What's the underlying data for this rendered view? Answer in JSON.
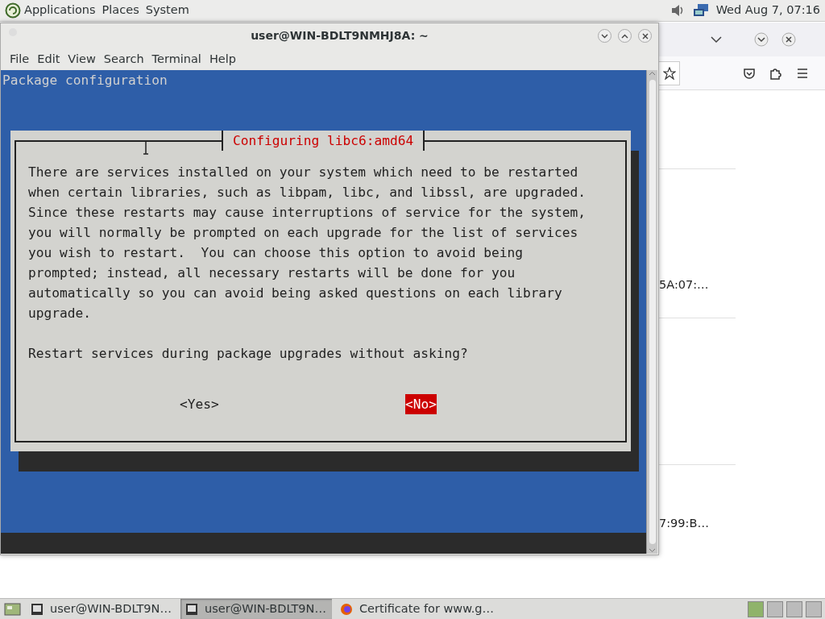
{
  "top_panel": {
    "menus": [
      "Applications",
      "Places",
      "System"
    ],
    "clock": "Wed Aug 7, 07:16"
  },
  "terminal_window": {
    "title": "user@WIN-BDLT9NMHJ8A: ~",
    "menu": [
      "File",
      "Edit",
      "View",
      "Search",
      "Terminal",
      "Help"
    ],
    "screen_title": "Package configuration",
    "dialog": {
      "title": "Configuring libc6:amd64",
      "lines": [
        "There are services installed on your system which need to be restarted",
        "when certain libraries, such as libpam, libc, and libssl, are upgraded.",
        "Since these restarts may cause interruptions of service for the system,",
        "you will normally be prompted on each upgrade for the list of services",
        "you wish to restart.  You can choose this option to avoid being",
        "prompted; instead, all necessary restarts will be done for you",
        "automatically so you can avoid being asked questions on each library",
        "upgrade."
      ],
      "question": "Restart services during package upgrades without asking?",
      "buttons": [
        {
          "label": "<Yes>",
          "selected": false
        },
        {
          "label": "<No>",
          "selected": true
        }
      ]
    }
  },
  "browser_window": {
    "rows": [
      {
        "text": ""
      },
      {
        "text": "5A:07:…"
      },
      {
        "text": ""
      },
      {
        "text": "7:99:B…"
      }
    ]
  },
  "taskbar": {
    "items": [
      {
        "kind": "terminal",
        "label": "user@WIN-BDLT9N…",
        "selected": false
      },
      {
        "kind": "terminal",
        "label": "user@WIN-BDLT9N…",
        "selected": true
      },
      {
        "kind": "browser",
        "label": "Certificate for www.g…",
        "selected": false
      }
    ]
  }
}
